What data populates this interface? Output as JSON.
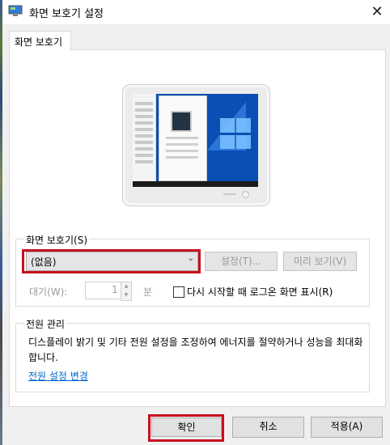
{
  "window": {
    "title": "화면 보호기 설정",
    "close_icon": "close-icon"
  },
  "tab": {
    "label": "화면 보호기"
  },
  "screensaver": {
    "group_label": "화면 보호기(S)",
    "selected": "(없음)",
    "settings_button": "설정(T)...",
    "preview_button": "미리 보기(V)",
    "wait_label": "대기(W):",
    "wait_value": "1",
    "wait_unit": "분",
    "logon_checkbox_label": "다시 시작할 때 로그온 화면 표시(R)",
    "logon_checked": false
  },
  "power": {
    "group_label": "전원 관리",
    "description": "디스플레이 밝기 및 기타 전원 설정을 조정하여 에너지를 절약하거나 성능을 최대화합니다.",
    "link": "전원 설정 변경"
  },
  "buttons": {
    "ok": "확인",
    "cancel": "취소",
    "apply": "적용(A)"
  },
  "colors": {
    "highlight": "#c7101e",
    "link": "#0066cc",
    "desktop": "#0a4fb3"
  }
}
